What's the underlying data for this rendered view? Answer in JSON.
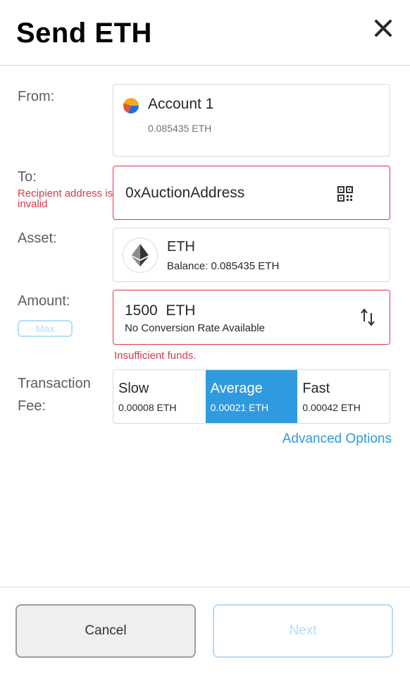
{
  "header": {
    "title": "Send ETH",
    "close_icon": "close-icon"
  },
  "from": {
    "label": "From:",
    "account_name": "Account 1",
    "balance": "0.085435 ETH"
  },
  "to": {
    "label": "To:",
    "error": "Recipient address is invalid",
    "value": "0xAuctionAddress",
    "qr_icon": "qr-code-icon"
  },
  "asset": {
    "label": "Asset:",
    "name": "ETH",
    "balance": "Balance: 0.085435 ETH"
  },
  "amount": {
    "label": "Amount:",
    "max_label": "Max",
    "value": "1500  ETH",
    "conversion": "No Conversion Rate Available",
    "error": "Insufficient funds."
  },
  "fee": {
    "label": "Transaction Fee:",
    "options": [
      {
        "name": "Slow",
        "amount": "0.00008 ETH",
        "selected": false
      },
      {
        "name": "Average",
        "amount": "0.00021 ETH",
        "selected": true
      },
      {
        "name": "Fast",
        "amount": "0.00042 ETH",
        "selected": false
      }
    ],
    "advanced_label": "Advanced Options"
  },
  "footer": {
    "cancel_label": "Cancel",
    "next_label": "Next"
  },
  "colors": {
    "accent": "#2f9ae0",
    "error": "#d73a49",
    "disabled": "#b6dcf5"
  }
}
